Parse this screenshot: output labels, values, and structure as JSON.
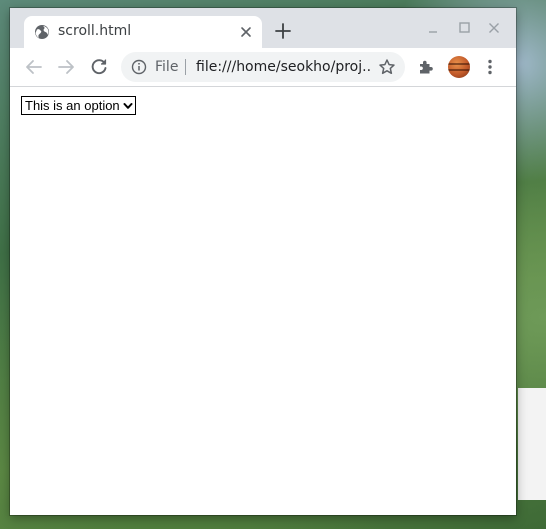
{
  "browser": {
    "tab": {
      "title": "scroll.html",
      "favicon": "globe-icon",
      "close_icon": "close-icon"
    },
    "new_tab_icon": "plus-icon",
    "window_controls": [
      "minimize-icon",
      "maximize-icon",
      "close-icon"
    ],
    "toolbar": {
      "back_icon": "arrow-left-icon",
      "forward_icon": "arrow-right-icon",
      "reload_icon": "reload-icon",
      "omnibox": {
        "info_icon": "info-icon",
        "scheme_label": "File",
        "url": "file:///home/seokho/proj...",
        "bookmark_icon": "star-icon"
      },
      "extensions_icon": "puzzle-icon",
      "profile_avatar": "avatar",
      "menu_icon": "kebab-menu-icon"
    }
  },
  "page": {
    "select": {
      "selected_option": "This is an option"
    }
  },
  "colors": {
    "titlebar": "#dee1e6",
    "tab": "#ffffff",
    "omnibox": "#f1f3f4",
    "icon": "#5f6368"
  }
}
